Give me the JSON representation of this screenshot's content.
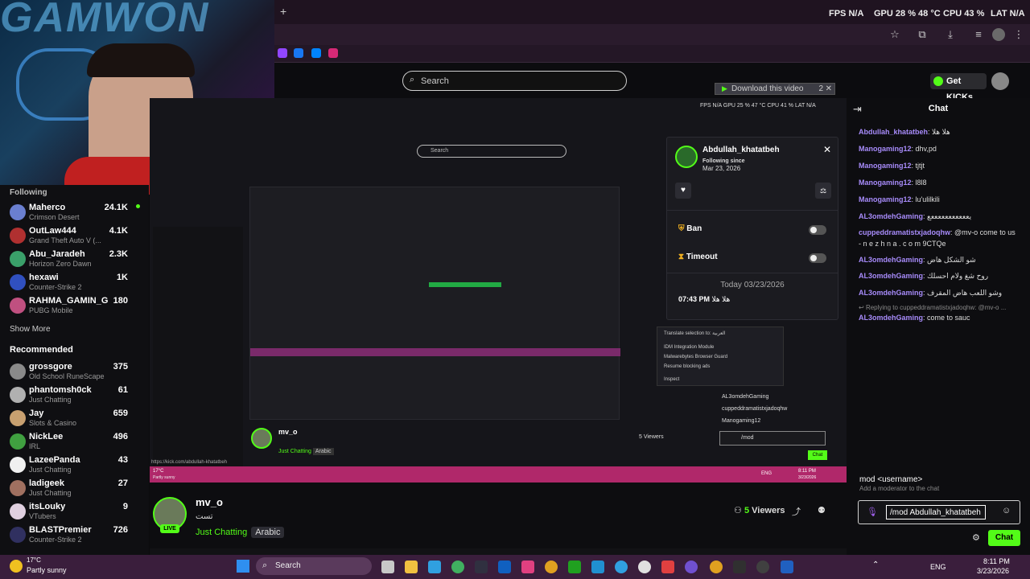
{
  "stats": {
    "fps_label": "FPS",
    "fps": "N/A",
    "gpu_label": "GPU",
    "gpu": "28 % 48 °C",
    "cpu_label": "CPU",
    "cpu": "43 %",
    "lat_label": "LAT",
    "lat": "N/A"
  },
  "webcam": {
    "overlay_text": "GAMWON"
  },
  "header": {
    "search_placeholder": "Search",
    "get_kicks": "Get KICKs",
    "download_btn": "Download this video",
    "download_count": "2"
  },
  "sidebar": {
    "following_label": "Following",
    "following": [
      {
        "name": "Maherco",
        "category": "Crimson Desert",
        "viewers": "24.1K",
        "color": "#6a7fd0"
      },
      {
        "name": "OutLaw444",
        "category": "Grand Theft Auto V (...",
        "viewers": "4.1K",
        "color": "#b03030"
      },
      {
        "name": "Abu_Jaradeh",
        "category": "Horizon Zero Dawn",
        "viewers": "2.3K",
        "color": "#3aa06a"
      },
      {
        "name": "hexawi",
        "category": "Counter-Strike 2",
        "viewers": "1K",
        "color": "#3050c0"
      },
      {
        "name": "RAHMA_GAMIN_G",
        "category": "PUBG Mobile",
        "viewers": "180",
        "color": "#c05080"
      }
    ],
    "show_more": "Show More",
    "recommended_label": "Recommended",
    "recommended": [
      {
        "name": "grossgore",
        "category": "Old School RuneScape",
        "viewers": "375",
        "color": "#8a8a8a"
      },
      {
        "name": "phantomsh0ck",
        "category": "Just Chatting",
        "viewers": "61",
        "color": "#b0b0b0"
      },
      {
        "name": "Jay",
        "category": "Slots & Casino",
        "viewers": "659",
        "color": "#c8a070"
      },
      {
        "name": "NickLee",
        "category": "IRL",
        "viewers": "496",
        "color": "#40a040"
      },
      {
        "name": "LazeePanda",
        "category": "Just Chatting",
        "viewers": "43",
        "color": "#f0f0f0"
      },
      {
        "name": "ladigeek",
        "category": "Just Chatting",
        "viewers": "27",
        "color": "#a07060"
      },
      {
        "name": "itsLouky",
        "category": "VTubers",
        "viewers": "9",
        "color": "#e0d0e0"
      },
      {
        "name": "BLASTPremier",
        "category": "Counter-Strike 2",
        "viewers": "726",
        "color": "#303060"
      }
    ]
  },
  "usercard": {
    "username": "Abdullah_khatatbeh",
    "following_since_label": "Following since",
    "following_since": "Mar 23, 2026",
    "ban": "Ban",
    "timeout": "Timeout",
    "date_sep": "Today 03/23/2026",
    "msg_time": "07:43 PM",
    "msg_text": "هلا هلا"
  },
  "chat": {
    "title": "Chat",
    "messages": [
      {
        "user": "Abdullah_khatatbeh",
        "text": "هلا هلا"
      },
      {
        "user": "Manogaming12",
        "text": "dhv,pd"
      },
      {
        "user": "Manogaming12",
        "text": "tjtjt"
      },
      {
        "user": "Manogaming12",
        "text": "l8l8"
      },
      {
        "user": "Manogaming12",
        "text": "lu'ulilkili"
      },
      {
        "user": "AL3omdehGaming",
        "text": "يعععععععععععع"
      },
      {
        "user": "cuppeddramatistxjadoqhw",
        "text": "@mv-o come to us"
      },
      {
        "user": "",
        "text": "- n e z h n a . c o m 9CTQe"
      },
      {
        "user": "AL3omdehGaming",
        "text": "شو الشكل هاض"
      },
      {
        "user": "AL3omdehGaming",
        "text": "روح شغ ولام احسلك"
      },
      {
        "user": "AL3omdehGaming",
        "text": "وشو اللعب هاض المقرف"
      },
      {
        "user": "",
        "text": "Replying to cuppeddramatistxjadoqhw: @mv-o ..."
      },
      {
        "user": "AL3omdehGaming",
        "text": "come to sauc"
      }
    ],
    "cmd_name": "mod <username>",
    "cmd_desc": "Add a moderator to the chat",
    "input_value": "/mod Abdullah_khatatbeh",
    "send": "Chat"
  },
  "stream_info": {
    "streamer": "mv_o",
    "title": "تست",
    "live": "LIVE",
    "category": "Just Chatting",
    "tag": "Arabic",
    "viewers": "5",
    "viewers_label": "Viewers"
  },
  "nested": {
    "card_user": "Abdullah_khatatbeh",
    "ban": "Ban",
    "timeout": "Timeout",
    "msg": "07:43 PM هلا هلا",
    "today": "Today 03/23",
    "ctx_translate": "Translate selection to: العربية",
    "ctx_idm": "IDM Integration Module",
    "ctx_mb": "Malwarebytes Browser Guard",
    "ctx_resume": "Resume blocking ads",
    "ctx_inspect": "Inspect",
    "chat_users": [
      "AL3omdehGaming",
      "cuppeddramatistxjadoqhw",
      "Manogaming12"
    ],
    "mod_input": "/mod",
    "chat_btn": "Chat",
    "streamer": "mv_o",
    "viewers": "5 Viewers",
    "category": "Just Chatting",
    "tag": "Arabic",
    "search": "Search",
    "url": "https://kick.com/abdullah-khatatbeh",
    "weather": "17°C",
    "weather2": "Partly sunny",
    "stats": "FPS N/A  GPU 25 % 47 °C  CPU 41 %  LAT N/A",
    "time": "8:11 PM",
    "date": "3/23/2026",
    "lang": "ENG"
  },
  "taskbar": {
    "weather_temp": "17°C",
    "weather_desc": "Partly sunny",
    "search": "Search",
    "lang": "ENG",
    "time": "8:11 PM",
    "date": "3/23/2026"
  }
}
